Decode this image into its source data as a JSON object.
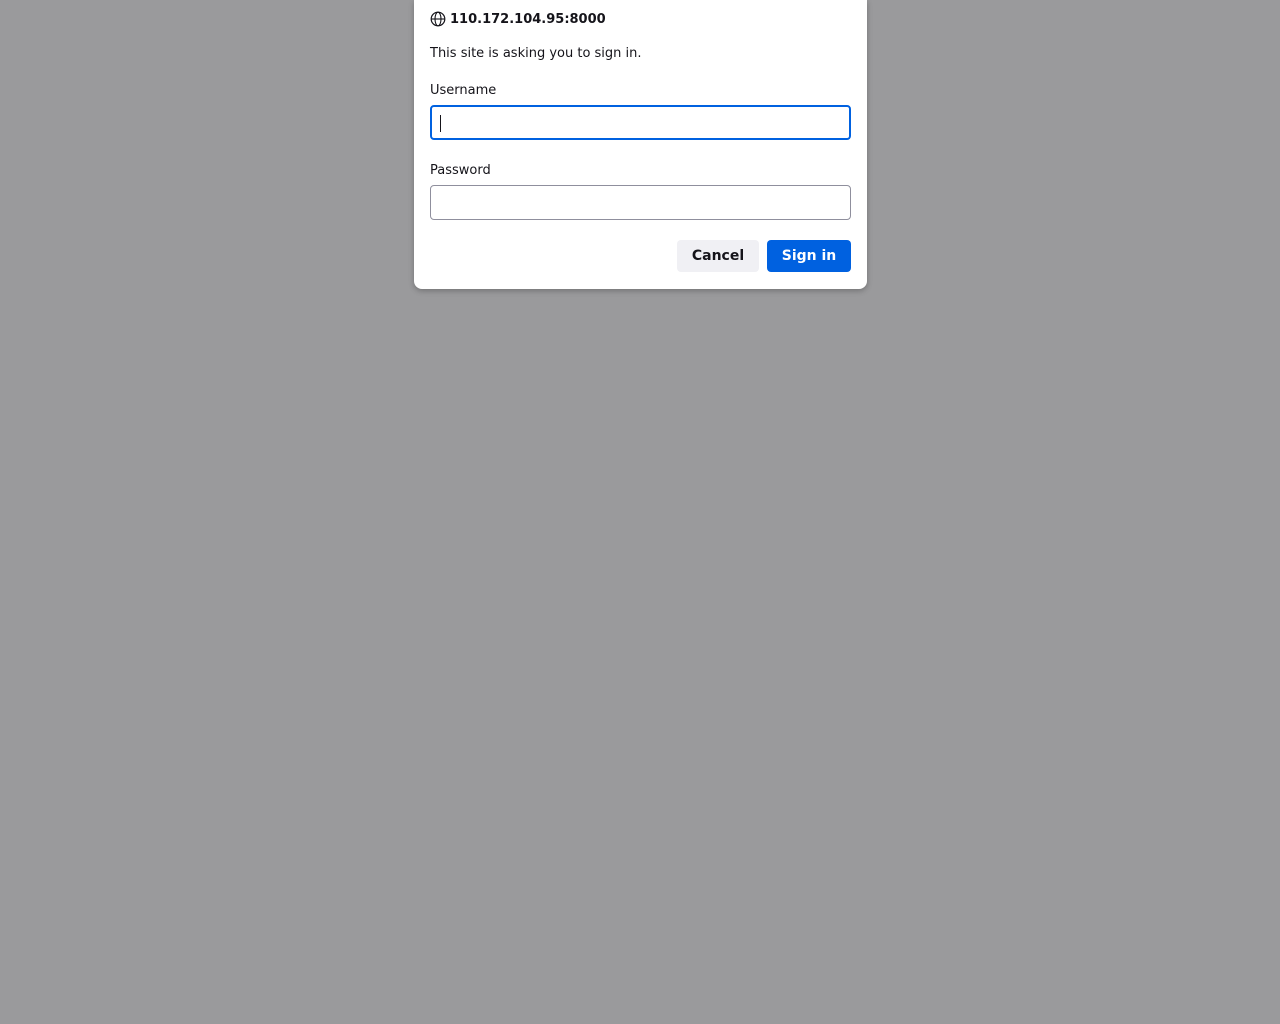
{
  "dialog": {
    "host": "110.172.104.95:8000",
    "host_icon": "globe-icon",
    "message": "This site is asking you to sign in.",
    "username_label": "Username",
    "username_value": "",
    "password_label": "Password",
    "password_value": "",
    "cancel_label": "Cancel",
    "signin_label": "Sign in"
  },
  "colors": {
    "backdrop": "#9a9a9c",
    "accent": "#0061e0",
    "secondary_button": "#f0f0f4",
    "text": "#15141a"
  }
}
